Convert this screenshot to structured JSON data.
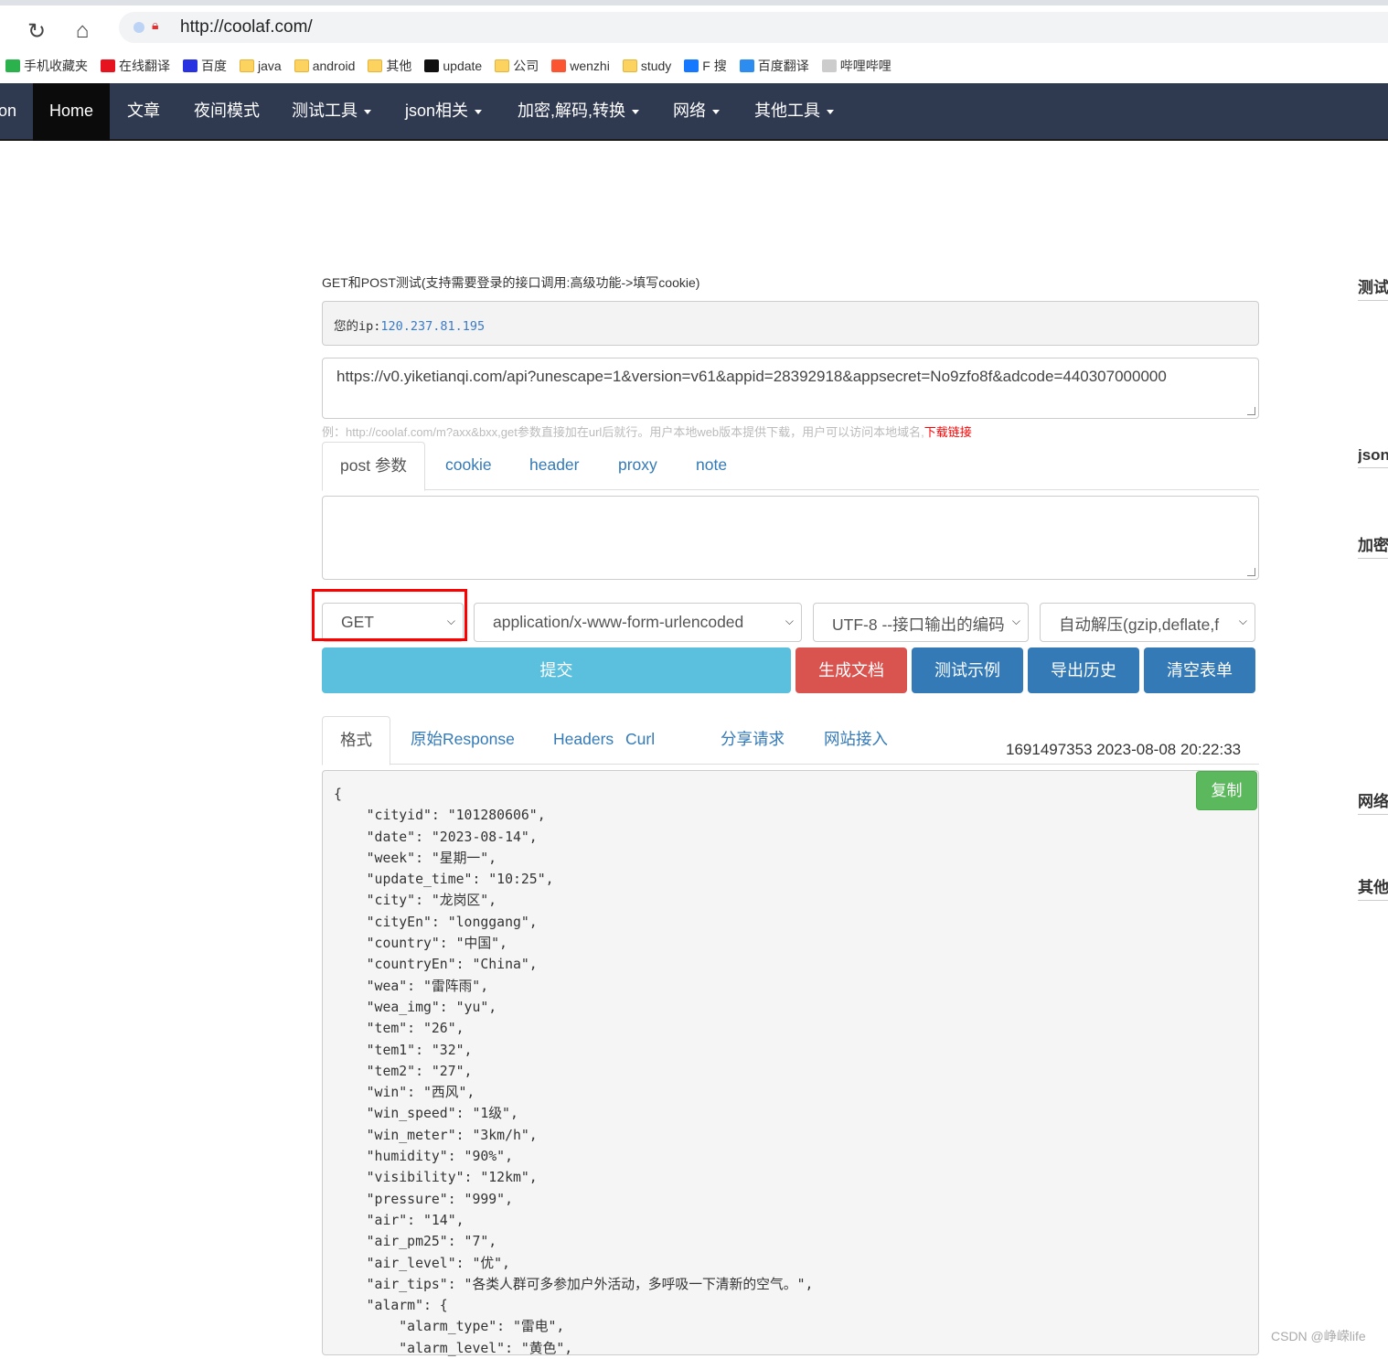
{
  "browser": {
    "url": "http://coolaf.com/",
    "bookmarks": [
      {
        "label": "手机收藏夹",
        "icon": "phone-icon",
        "color": "#2bb24c"
      },
      {
        "label": "在线翻译",
        "icon": "youdao-icon",
        "color": "#e5141f"
      },
      {
        "label": "百度",
        "icon": "baidu-paw-icon",
        "color": "#2932e1"
      },
      {
        "label": "java",
        "icon": "folder-icon"
      },
      {
        "label": "android",
        "icon": "folder-icon"
      },
      {
        "label": "其他",
        "icon": "folder-icon"
      },
      {
        "label": "update",
        "icon": "github-icon",
        "color": "#111111"
      },
      {
        "label": "公司",
        "icon": "folder-icon"
      },
      {
        "label": "wenzhi",
        "icon": "csdn-icon",
        "color": "#fc5531"
      },
      {
        "label": "study",
        "icon": "folder-icon"
      },
      {
        "label": "F 搜",
        "icon": "f-icon",
        "color": "#1677ff"
      },
      {
        "label": "百度翻译",
        "icon": "translate-icon",
        "color": "#2d8cf0"
      },
      {
        "label": "哔哩哔哩",
        "icon": "page-icon",
        "color": "#cccccc"
      }
    ]
  },
  "nav": {
    "brand_fragment": "on",
    "items": [
      {
        "label": "Home",
        "dropdown": false
      },
      {
        "label": "文章",
        "dropdown": false
      },
      {
        "label": "夜间模式",
        "dropdown": false
      },
      {
        "label": "测试工具",
        "dropdown": true
      },
      {
        "label": "json相关",
        "dropdown": true
      },
      {
        "label": "加密,解码,转换",
        "dropdown": true
      },
      {
        "label": "网络",
        "dropdown": true
      },
      {
        "label": "其他工具",
        "dropdown": true
      }
    ]
  },
  "main": {
    "intro": "GET和POST测试(支持需要登录的接口调用:高级功能->填写cookie)",
    "ip_label": "您的ip:",
    "ip_value": "120.237.81.195",
    "url_value": "https://v0.yiketianqi.com/api?unescape=1&version=v61&appid=28392918&appsecret=No9zfo8f&adcode=440307000000",
    "hint": "例：http://coolaf.com/m?axx&bxx,get参数直接加在url后就行。用户本地web版本提供下载，用户可以访问本地域名,",
    "hint_link": "下载链接",
    "request_tabs": [
      "post 参数",
      "cookie",
      "header",
      "proxy",
      "note"
    ],
    "post_body": "",
    "method": "GET",
    "content_type": "application/x-www-form-urlencoded",
    "encoding": "UTF-8 --接口输出的编码",
    "decompress": "自动解压(gzip,deflate,f",
    "buttons": {
      "submit": "提交",
      "gen_doc": "生成文档",
      "example": "测试示例",
      "export": "导出历史",
      "clear": "清空表单"
    },
    "response_tabs": [
      "格式",
      "原始Response",
      "Headers",
      "Curl",
      "分享请求",
      "网站接入"
    ],
    "timestamp": "1691497353 2023-08-08 20:22:33",
    "copy_label": "复制",
    "response_lines": [
      "{",
      "    \"cityid\": \"101280606\",",
      "    \"date\": \"2023-08-14\",",
      "    \"week\": \"星期一\",",
      "    \"update_time\": \"10:25\",",
      "    \"city\": \"龙岗区\",",
      "    \"cityEn\": \"longgang\",",
      "    \"country\": \"中国\",",
      "    \"countryEn\": \"China\",",
      "    \"wea\": \"雷阵雨\",",
      "    \"wea_img\": \"yu\",",
      "    \"tem\": \"26\",",
      "    \"tem1\": \"32\",",
      "    \"tem2\": \"27\",",
      "    \"win\": \"西风\",",
      "    \"win_speed\": \"1级\",",
      "    \"win_meter\": \"3km/h\",",
      "    \"humidity\": \"90%\",",
      "    \"visibility\": \"12km\",",
      "    \"pressure\": \"999\",",
      "    \"air\": \"14\",",
      "    \"air_pm25\": \"7\",",
      "    \"air_level\": \"优\",",
      "    \"air_tips\": \"各类人群可多参加户外活动，多呼吸一下清新的空气。\",",
      "    \"alarm\": {",
      "        \"alarm_type\": \"雷电\",",
      "        \"alarm_level\": \"黄色\","
    ]
  },
  "sidebar": {
    "headings": [
      "测试",
      "json",
      "加密",
      "网络",
      "其他"
    ]
  },
  "watermark": "CSDN @峥嵘life"
}
